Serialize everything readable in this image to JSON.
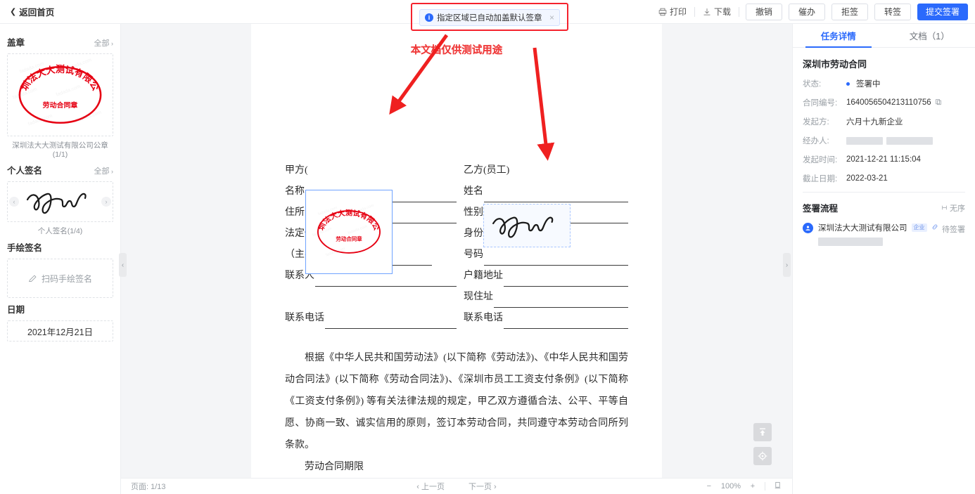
{
  "topbar": {
    "back_label": "返回首页",
    "print_label": "打印",
    "download_label": "下载",
    "buttons": [
      {
        "label": "撤销",
        "primary": false
      },
      {
        "label": "催办",
        "primary": false
      },
      {
        "label": "拒签",
        "primary": false
      },
      {
        "label": "转签",
        "primary": false
      },
      {
        "label": "提交签署",
        "primary": true
      }
    ]
  },
  "notification": {
    "text": "指定区域已自动加盖默认签章",
    "close_label": "×",
    "highlight_color": "#f5222d",
    "accent_color": "#2b6afc"
  },
  "sidebar": {
    "stamp": {
      "title": "盖章",
      "all_label": "全部",
      "caption": "深圳法大大测试有限公司公章(1/1)",
      "seal_top_text": "深圳法大大测试有限公司",
      "seal_bottom_text": "劳动合同章",
      "seal_color": "#e60012"
    },
    "personal_signature": {
      "title": "个人签名",
      "all_label": "全部",
      "caption": "个人签名(1/4)",
      "prev_label": "‹",
      "next_label": "›"
    },
    "handwritten": {
      "title": "手绘签名",
      "action_label": "扫码手绘签名"
    },
    "date": {
      "title": "日期",
      "value": "2021年12月21日"
    }
  },
  "document": {
    "watermark_top": "本文档仅供测试用途",
    "watermark_sub": "本文档仅供测试用途",
    "party_a": {
      "header": "甲方(",
      "fields": [
        {
          "label": "名称",
          "line": true
        },
        {
          "label": "住所",
          "line": true
        },
        {
          "label": "法定代表人",
          "line": false
        },
        {
          "label": "（主要负责人）",
          "line": true
        },
        {
          "label": "联系人",
          "line": true
        },
        {
          "label": "",
          "line": false
        },
        {
          "label": "联系电话",
          "line": true
        }
      ]
    },
    "party_b": {
      "header": "乙方(员工)",
      "fields": [
        {
          "label": "姓名",
          "line": true
        },
        {
          "label": "性别",
          "line": true
        },
        {
          "label": "身份证（护照）",
          "line": false
        },
        {
          "label": "号码",
          "line": true
        },
        {
          "label": "户籍地址",
          "line": true
        },
        {
          "label": "现住址",
          "line": true
        },
        {
          "label": "联系电话",
          "line": true
        }
      ]
    },
    "paragraph": "根据《中华人民共和国劳动法》(以下简称《劳动法》)、《中华人民共和国劳动合同法》(以下简称《劳动合同法》)、《深圳市员工工资支付条例》(以下简称《工资支付条例》) 等有关法律法规的规定，甲乙双方遵循合法、公平、平等自愿、协商一致、诚实信用的原则，签订本劳动合同，共同遵守本劳动合同所列条款。",
    "next_heading": "劳动合同期限",
    "float_buttons": [
      {
        "name": "scroll-top",
        "label": "⬆"
      },
      {
        "name": "locate",
        "label": "◎"
      }
    ]
  },
  "bottombar": {
    "page_label": "页面:",
    "page_value": "1/13",
    "prev_page": "上一页",
    "next_page": "下一页",
    "zoom_out": "−",
    "zoom_level": "100%",
    "zoom_in": "+",
    "fit_label": "▯"
  },
  "right_panel": {
    "tabs": [
      {
        "label": "任务详情",
        "active": true
      },
      {
        "label": "文档（1）",
        "active": false
      }
    ],
    "contract_title": "深圳市劳动合同",
    "details": [
      {
        "key": "状态:",
        "value": "签署中",
        "type": "status"
      },
      {
        "key": "合同编号:",
        "value": "1640056504213110756",
        "type": "copy"
      },
      {
        "key": "发起方:",
        "value": "六月十九新企业",
        "type": "text"
      },
      {
        "key": "经办人:",
        "value": "",
        "type": "masked"
      },
      {
        "key": "发起时间:",
        "value": "2021-12-21 11:15:04",
        "type": "text"
      },
      {
        "key": "截止日期:",
        "value": "2022-03-21",
        "type": "text"
      }
    ],
    "flow": {
      "title": "签署流程",
      "order_label": "无序",
      "participants": [
        {
          "name": "深圳法大大测试有限公司",
          "badge": "企业",
          "status": "待签署",
          "masked_sub": true
        }
      ]
    }
  },
  "handles": {
    "left_collapse": "‹",
    "right_collapse": "›"
  }
}
